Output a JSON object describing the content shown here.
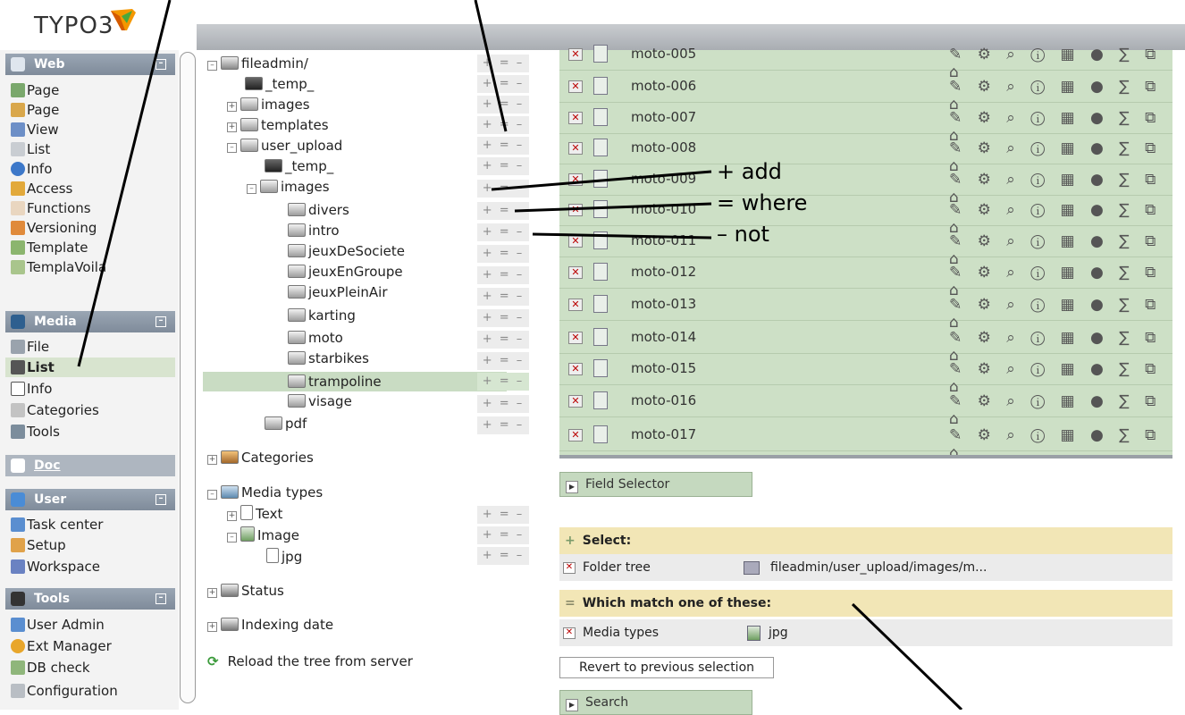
{
  "logo": {
    "text": "TYPO3"
  },
  "modules": {
    "web": {
      "label": "Web",
      "items": [
        "Page",
        "Page",
        "View",
        "List",
        "Info",
        "Access",
        "Functions",
        "Versioning",
        "Template",
        "TemplaVoila"
      ]
    },
    "media": {
      "label": "Media",
      "items": [
        "File",
        "List",
        "Info",
        "Categories",
        "Tools"
      ],
      "selected": "List"
    },
    "doc": {
      "label": "Doc"
    },
    "user": {
      "label": "User",
      "items": [
        "Task center",
        "Setup",
        "Workspace"
      ]
    },
    "tools": {
      "label": "Tools",
      "items": [
        "User Admin",
        "Ext Manager",
        "DB check",
        "Configuration"
      ]
    }
  },
  "tree": {
    "nodes": [
      "fileadmin/",
      "_temp_",
      "images",
      "templates",
      "user_upload",
      "_temp_",
      "images",
      "divers",
      "intro",
      "jeuxDeSociete",
      "jeuxEnGroupe",
      "jeuxPleinAir",
      "karting",
      "moto",
      "starbikes",
      "trampoline",
      "visage",
      "pdf"
    ],
    "selected": "trampoline",
    "categories": "Categories",
    "media_types": "Media types",
    "media_type_nodes": [
      "Text",
      "Image",
      "jpg"
    ],
    "status": "Status",
    "indexing_date": "Indexing date",
    "reload": "Reload the tree from server",
    "pem_label": "+ = –"
  },
  "files": [
    "moto-005",
    "moto-006",
    "moto-007",
    "moto-008",
    "moto-009",
    "moto-010",
    "moto-011",
    "moto-012",
    "moto-013",
    "moto-014",
    "moto-015",
    "moto-016",
    "moto-017"
  ],
  "row_actions": "✎ ⚙ ⌕ ⓘ ▦ ● ∑ ⧉ ⌂",
  "field_selector": "Field Selector",
  "selection": {
    "select_label": "Select:",
    "folder_tree_label": "Folder tree",
    "folder_tree_value": "fileadmin/user_upload/images/m...",
    "match_label": "Which match one of these:",
    "media_types_label": "Media types",
    "media_types_value": "jpg"
  },
  "revert_button": "Revert to previous selection",
  "search_button": "Search",
  "annotations": {
    "add": "+ add",
    "where": "= where",
    "not": "– not"
  },
  "colors": {
    "selected_green": "#d8e4cf",
    "list_green": "#cde0c6",
    "header_yellow": "#f2e6b6",
    "module_header": "#8a96a5"
  }
}
